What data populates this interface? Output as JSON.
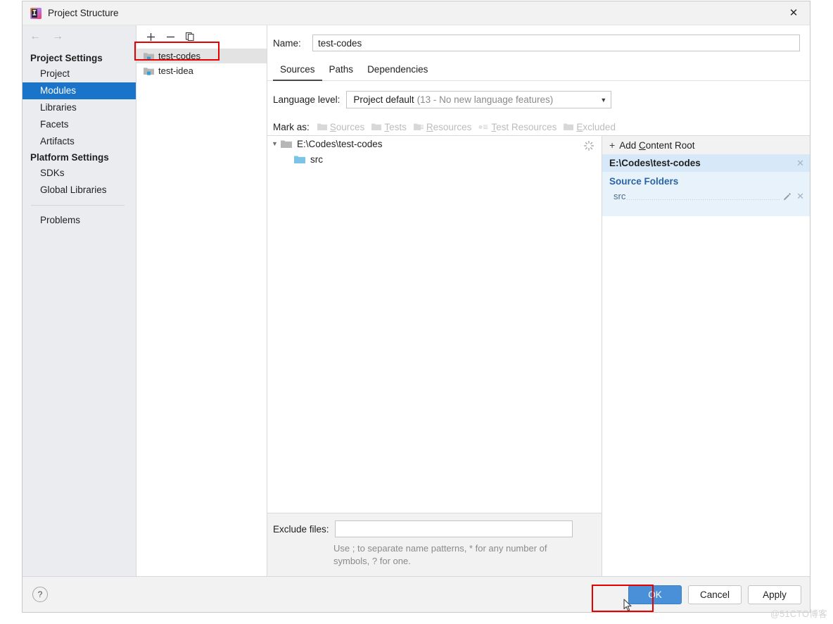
{
  "window": {
    "title": "Project Structure",
    "icon": "intellij-idea-logo-icon",
    "close_label": "✕"
  },
  "nav": {
    "back_label": "←",
    "forward_label": "→",
    "groups": [
      {
        "label": "Project Settings",
        "items": [
          {
            "label": "Project",
            "selected": false
          },
          {
            "label": "Modules",
            "selected": true
          },
          {
            "label": "Libraries",
            "selected": false
          },
          {
            "label": "Facets",
            "selected": false
          },
          {
            "label": "Artifacts",
            "selected": false
          }
        ]
      },
      {
        "label": "Platform Settings",
        "items": [
          {
            "label": "SDKs",
            "selected": false
          },
          {
            "label": "Global Libraries",
            "selected": false
          }
        ]
      }
    ],
    "extra_items": [
      {
        "label": "Problems",
        "selected": false
      }
    ]
  },
  "modules": {
    "toolbar": {
      "add_label": "+",
      "remove_label": "−",
      "copy_label": "copy-icon"
    },
    "items": [
      {
        "label": "test-codes",
        "selected": true
      },
      {
        "label": "test-idea",
        "selected": false
      }
    ]
  },
  "module_detail": {
    "name_label": "Name:",
    "name_value": "test-codes",
    "tabs": [
      {
        "label": "Sources",
        "active": true
      },
      {
        "label": "Paths",
        "active": false
      },
      {
        "label": "Dependencies",
        "active": false
      }
    ],
    "language_level": {
      "label": "Language level:",
      "value_main": "Project default",
      "value_detail": "(13 - No new language features)",
      "arrow": "▼"
    },
    "mark_as": {
      "label": "Mark as:",
      "buttons": [
        {
          "pre": "",
          "mnemonic": "S",
          "post": "ources",
          "icon": "sources-folder-icon"
        },
        {
          "pre": "",
          "mnemonic": "T",
          "post": "ests",
          "icon": "tests-folder-icon"
        },
        {
          "pre": "",
          "mnemonic": "R",
          "post": "esources",
          "icon": "resources-folder-icon"
        },
        {
          "pre": "",
          "mnemonic": "T",
          "post": "est Resources",
          "icon": "test-resources-folder-icon"
        },
        {
          "pre": "",
          "mnemonic": "E",
          "post": "xcluded",
          "icon": "excluded-folder-icon"
        }
      ]
    },
    "tree": {
      "root": {
        "label": "E:\\Codes\\test-codes",
        "expander": "▼"
      },
      "children": [
        {
          "label": "src"
        }
      ],
      "spinner": "loading-spinner-icon"
    },
    "exclude": {
      "label": "Exclude files:",
      "value": "",
      "hint": "Use ; to separate name patterns, * for any number of symbols, ? for one."
    }
  },
  "content_roots": {
    "add_root": {
      "plus": "+",
      "pre": "Add ",
      "mnemonic": "C",
      "post": "ontent Root"
    },
    "root_path": "E:\\Codes\\test-codes",
    "root_remove_label": "✕",
    "source_folders_title": "Source Folders",
    "source_folders": [
      {
        "name": "src",
        "edit_label": "pencil-edit-icon",
        "remove_label": "✕"
      }
    ]
  },
  "footer": {
    "help_label": "?",
    "ok_label": "OK",
    "cancel_label": "Cancel",
    "apply_label": "Apply"
  },
  "watermark": "@51CTO博客",
  "colors": {
    "selection_blue": "#1a74c9",
    "primary_button": "#4a90d9",
    "annotation_red": "#e60000",
    "source_folder_blue": "#7bc4e8",
    "panel_blue": "#e8f2fb"
  }
}
